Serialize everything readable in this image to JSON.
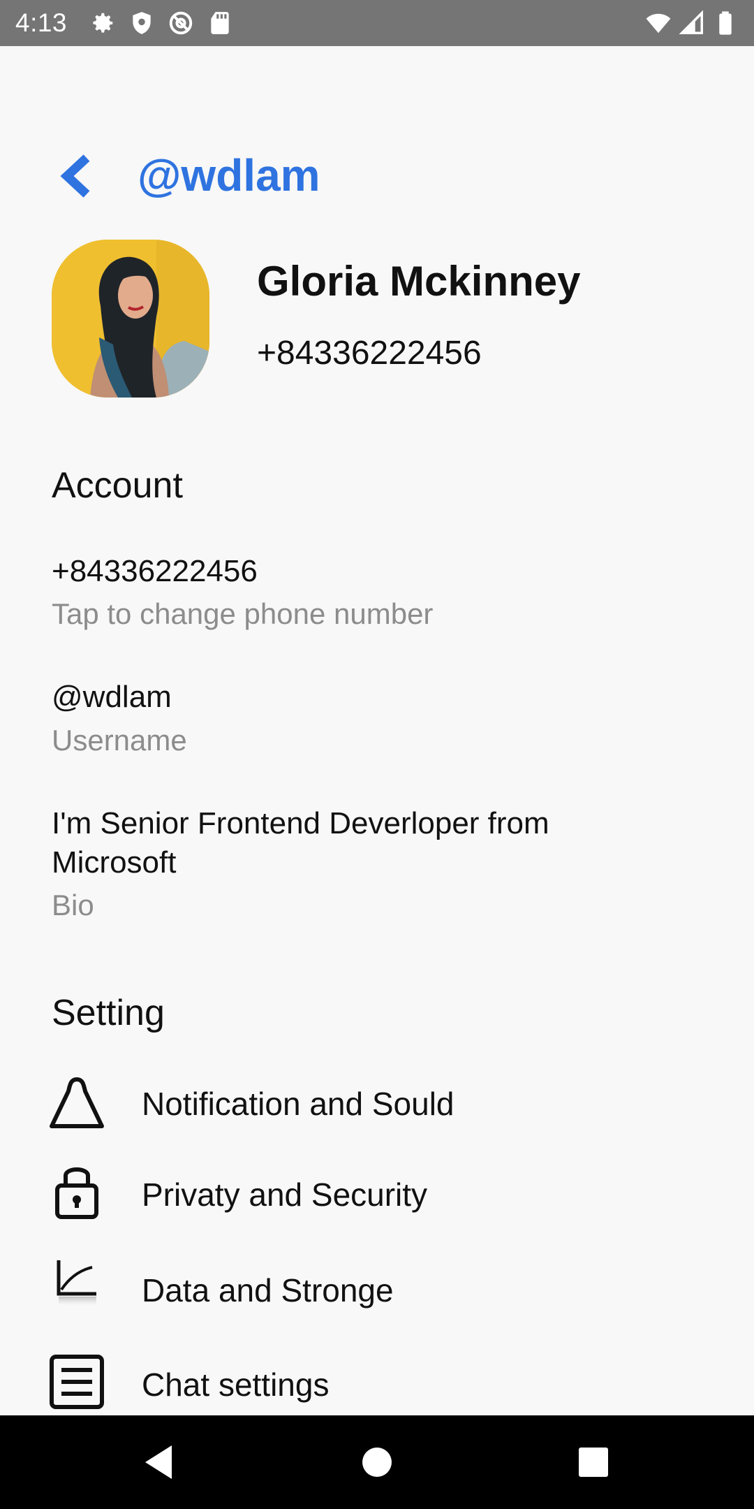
{
  "status_bar": {
    "time": "4:13",
    "left_icons": [
      "gear-icon",
      "shield-icon",
      "at-sign-icon",
      "sd-card-icon"
    ],
    "right_icons": [
      "wifi-icon",
      "cell-signal-icon",
      "battery-icon"
    ]
  },
  "header": {
    "title": "@wdlam",
    "back_icon": "chevron-left-icon",
    "accent_color": "#2f73e0"
  },
  "profile": {
    "name": "Gloria Mckinney",
    "phone": "+84336222456"
  },
  "account": {
    "section_title": "Account",
    "phone_value": "+84336222456",
    "phone_hint": "Tap to change phone number",
    "username_value": "@wdlam",
    "username_hint": "Username",
    "bio_value": "I'm Senior Frontend Deverloper from Microsoft",
    "bio_hint": "Bio"
  },
  "settings": {
    "section_title": "Setting",
    "items": [
      {
        "label": "Notification and Sould",
        "icon": "bell-icon"
      },
      {
        "label": "Privaty and Security",
        "icon": "lock-icon"
      },
      {
        "label": "Data and Stronge",
        "icon": "chart-icon"
      },
      {
        "label": "Chat settings",
        "icon": "chat-list-icon"
      }
    ]
  },
  "nav_bar": {
    "buttons": [
      "back-triangle-icon",
      "home-circle-icon",
      "recents-square-icon"
    ]
  }
}
